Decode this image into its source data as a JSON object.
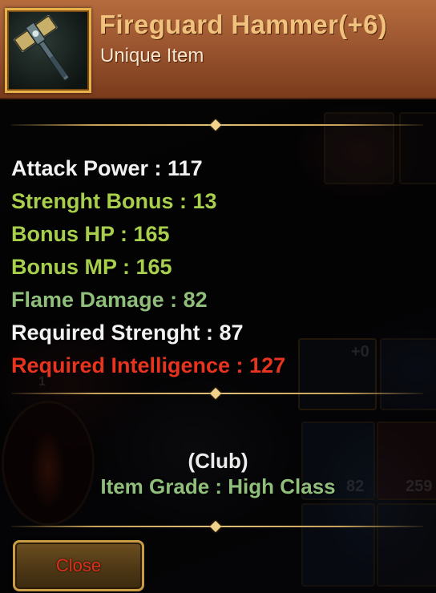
{
  "item": {
    "name": "Fireguard Hammer(+6)",
    "rarity": "Unique Item",
    "icon": "war-hammer-icon",
    "type": "(Club)",
    "grade": "Item Grade : High Class"
  },
  "stats": [
    {
      "text": "Attack Power : 117",
      "color": "#f2f2f2"
    },
    {
      "text": "Strenght Bonus : 13",
      "color": "#a7cf4b"
    },
    {
      "text": "Bonus HP : 165",
      "color": "#a7cf4b"
    },
    {
      "text": "Bonus MP : 165",
      "color": "#a7cf4b"
    },
    {
      "text": "Flame Damage : 82",
      "color": "#8fbf7a"
    },
    {
      "text": "Required Strenght : 87",
      "color": "#f2f2f2"
    },
    {
      "text": "Required Intelligence : 127",
      "color": "#e8341e"
    }
  ],
  "actions": {
    "close_label": "Close"
  },
  "background": {
    "counts": [
      "+0",
      "1",
      "82",
      "259"
    ]
  },
  "colors": {
    "header": "#9c5630",
    "item_name": "#f1c27e",
    "divider": "#c8a25a",
    "close_text": "#e0301c"
  }
}
